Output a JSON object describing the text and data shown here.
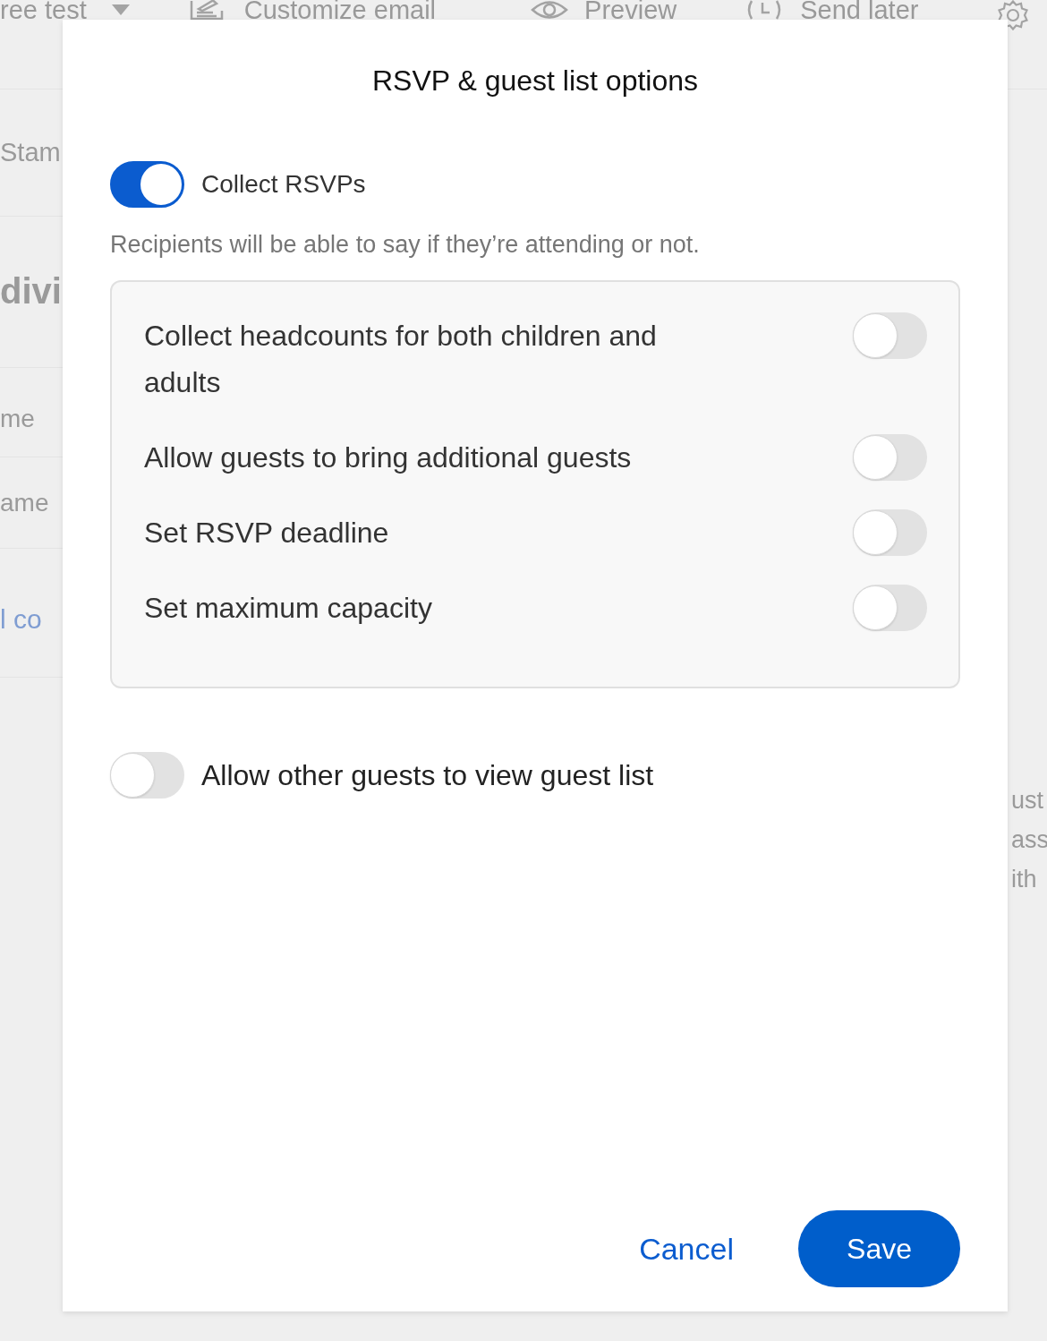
{
  "background": {
    "toolbar": [
      {
        "kind": "dropdown",
        "label": "ree test"
      },
      {
        "kind": "customize",
        "label": "Customize email"
      },
      {
        "kind": "preview",
        "label": "Preview"
      },
      {
        "kind": "schedule",
        "label": "Send later"
      },
      {
        "kind": "settings"
      }
    ],
    "left_texts": [
      {
        "kind": "plain",
        "text": "Stam"
      },
      {
        "kind": "heading",
        "text": "divi"
      },
      {
        "kind": "small",
        "text": "me"
      },
      {
        "kind": "small",
        "text": "ame"
      },
      {
        "kind": "link",
        "text": "l co"
      }
    ],
    "right_texts": [
      "ust",
      "ass",
      "ith"
    ]
  },
  "dialog": {
    "title": "RSVP & guest list options",
    "main_toggle": {
      "label": "Collect RSVPs",
      "on": true
    },
    "description": "Recipients will be able to say if they’re attending or not.",
    "options": [
      {
        "label": "Collect headcounts for both children and adults",
        "on": false
      },
      {
        "label": "Allow guests to bring additional guests",
        "on": false
      },
      {
        "label": "Set RSVP deadline",
        "on": false
      },
      {
        "label": "Set maximum capacity",
        "on": false
      }
    ],
    "guest_list_toggle": {
      "label": "Allow other guests to view guest list",
      "on": false
    },
    "buttons": [
      {
        "kind": "link",
        "label": "Cancel"
      },
      {
        "kind": "primary",
        "label": "Save"
      }
    ]
  }
}
